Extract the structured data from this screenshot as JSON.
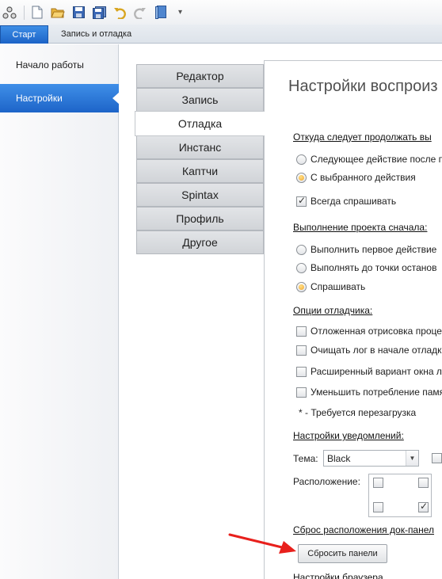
{
  "toolbar": {
    "icons": [
      "network-icon",
      "new-file-icon",
      "open-folder-icon",
      "save-icon",
      "save-all-icon",
      "undo-icon",
      "redo-icon",
      "book-icon",
      "customize-dropdown-icon"
    ]
  },
  "ribbon": {
    "tabs": [
      {
        "label": "Старт",
        "active": true
      },
      {
        "label": "Запись и отладка",
        "active": false
      }
    ]
  },
  "sidebar": {
    "items": [
      {
        "label": "Начало работы",
        "active": false
      },
      {
        "label": "Настройки",
        "active": true
      }
    ]
  },
  "categories": [
    {
      "label": "Редактор",
      "active": false
    },
    {
      "label": "Запись",
      "active": false
    },
    {
      "label": "Отладка",
      "active": true
    },
    {
      "label": "Инстанс",
      "active": false
    },
    {
      "label": "Каптчи",
      "active": false
    },
    {
      "label": "Spintax",
      "active": false
    },
    {
      "label": "Профиль",
      "active": false
    },
    {
      "label": "Другое",
      "active": false
    }
  ],
  "panel": {
    "title": "Настройки воспроиз",
    "continue_section": {
      "heading": "Откуда следует продолжать вы",
      "options": [
        {
          "label": "Следующее действие после п",
          "checked": false
        },
        {
          "label": "С выбранного действия",
          "checked": true
        }
      ],
      "always_ask": {
        "label": "Всегда спрашивать",
        "checked": true
      }
    },
    "restart_section": {
      "heading": "Выполнение проекта сначала:",
      "options": [
        {
          "label": "Выполнить первое действие",
          "checked": false
        },
        {
          "label": "Выполнять до точки останов",
          "checked": false
        },
        {
          "label": "Спрашивать",
          "checked": true
        }
      ]
    },
    "debugger_section": {
      "heading": "Опции отладчика:",
      "options": [
        {
          "label": "Отложенная отрисовка проце",
          "checked": false
        },
        {
          "label": "Очищать лог в начале отладк",
          "checked": false
        },
        {
          "label": "Расширенный вариант окна ло",
          "checked": false
        },
        {
          "label": "Уменьшить потребление памя",
          "checked": false
        }
      ],
      "note": "* - Требуется перезагрузка"
    },
    "notifications_section": {
      "heading": "Настройки уведомлений:",
      "theme_label": "Тема:",
      "theme_value": "Black",
      "extra_checkbox_checked": false,
      "position_label": "Расположение:",
      "position_grid": [
        {
          "corner": "top-left",
          "checked": false
        },
        {
          "corner": "top-right",
          "checked": false
        },
        {
          "corner": "bottom-left",
          "checked": false
        },
        {
          "corner": "bottom-right",
          "checked": true
        }
      ]
    },
    "reset_section": {
      "heading": "Сброс расположения док-панел",
      "button_label": "Сбросить панели"
    },
    "browser_section": {
      "heading": "Настройки браузера"
    }
  },
  "colors": {
    "accent": "#1d64c8",
    "radio_selected": "#f2a62b",
    "annotation_arrow": "#e8201c"
  }
}
